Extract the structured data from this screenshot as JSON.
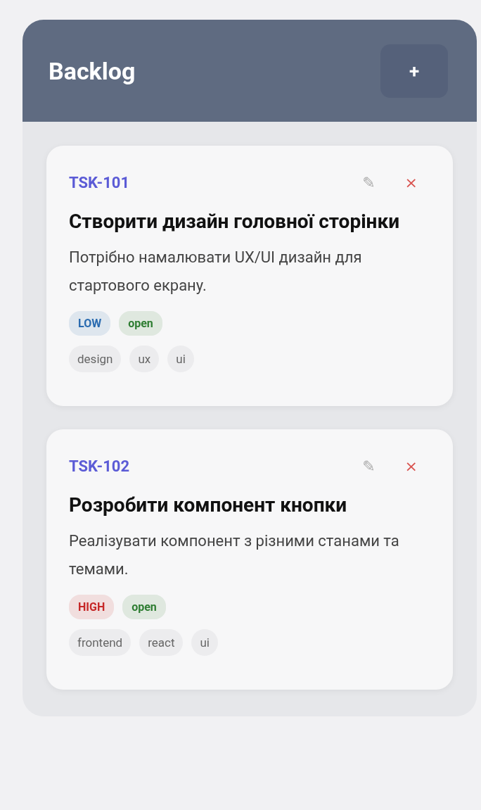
{
  "column": {
    "title": "Backlog",
    "add_button": "+"
  },
  "cards": [
    {
      "id": "TSK-101",
      "edit": "✎",
      "delete": "×",
      "title": "Створити дизайн головної сторінки",
      "description": "Потрібно намалювати UX/UI дизайн для стартового екрану.",
      "priority": {
        "label": "LOW",
        "color": "#2a6bb0"
      },
      "status": {
        "label": "open",
        "color": "#2e7d32"
      },
      "tags": [
        "design",
        "ux",
        "ui"
      ]
    },
    {
      "id": "TSK-102",
      "edit": "✎",
      "delete": "×",
      "title": "Розробити компонент кнопки",
      "description": "Реалізувати компонент з різними станами та темами.",
      "priority": {
        "label": "HIGH",
        "color": "#c62828"
      },
      "status": {
        "label": "open",
        "color": "#2e7d32"
      },
      "tags": [
        "frontend",
        "react",
        "ui"
      ]
    }
  ]
}
